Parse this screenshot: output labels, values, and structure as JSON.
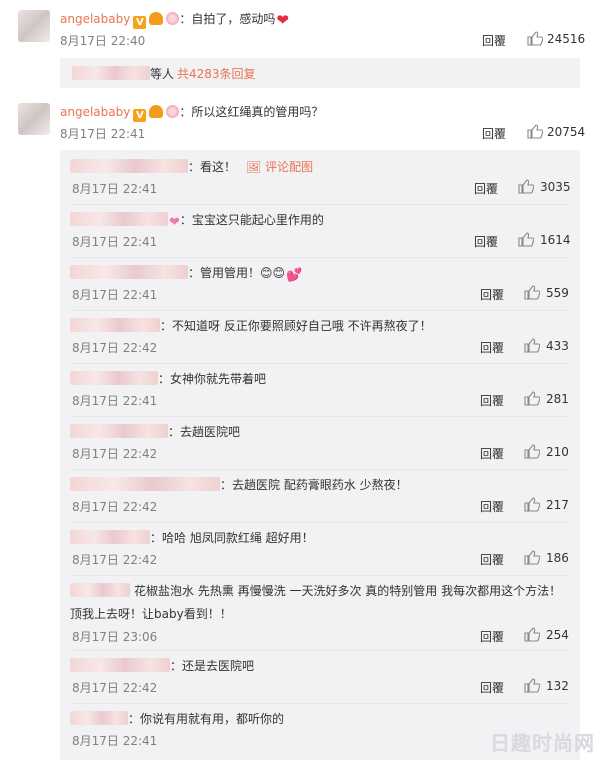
{
  "comments": [
    {
      "user": "angelababy",
      "text": "：自拍了，感动吗",
      "time": "8月17日 22:40",
      "reply": "回覆",
      "likes": "24516"
    },
    {
      "user": "angelababy",
      "text": "：所以这红绳真的管用吗？",
      "time": "8月17日 22:41",
      "reply": "回覆",
      "likes": "20754"
    }
  ],
  "more": {
    "prefix": "等人",
    "link": "共4283条回复"
  },
  "replies": [
    {
      "text": "：看这！",
      "extra": "评论配图",
      "time": "8月17日 22:41",
      "reply": "回覆",
      "likes": "3035"
    },
    {
      "text": "：宝宝这只能起心里作用的",
      "time": "8月17日 22:41",
      "reply": "回覆",
      "likes": "1614"
    },
    {
      "text": "：管用管用！😊😊",
      "time": "8月17日 22:41",
      "reply": "回覆",
      "likes": "559"
    },
    {
      "text": "：不知道呀 反正你要照顾好自己哦 不许再熬夜了！",
      "time": "8月17日 22:42",
      "reply": "回覆",
      "likes": "433"
    },
    {
      "text": "：女神你就先带着吧",
      "time": "8月17日 22:41",
      "reply": "回覆",
      "likes": "281"
    },
    {
      "text": "：去趟医院吧",
      "time": "8月17日 22:42",
      "reply": "回覆",
      "likes": "210"
    },
    {
      "text": "：去趟医院 配药膏眼药水 少熬夜！",
      "time": "8月17日 22:42",
      "reply": "回覆",
      "likes": "217"
    },
    {
      "text": "：哈哈 旭凤同款红绳 超好用！",
      "time": "8月17日 22:42",
      "reply": "回覆",
      "likes": "186"
    },
    {
      "text": "花椒盐泡水 先热熏 再慢慢洗 一天洗好多次 真的特别管用 我每次都用这个方法！",
      "text2": "顶我上去呀！让baby看到！！",
      "time": "8月17日 23:06",
      "reply": "回覆",
      "likes": "254"
    },
    {
      "text": "：还是去医院吧",
      "time": "8月17日 22:42",
      "reply": "回覆",
      "likes": "132"
    },
    {
      "text": "：你说有用就有用，都听你的",
      "time": "8月17日 22:41",
      "reply": "",
      "likes": ""
    }
  ],
  "watermark": "日趣时尚网"
}
